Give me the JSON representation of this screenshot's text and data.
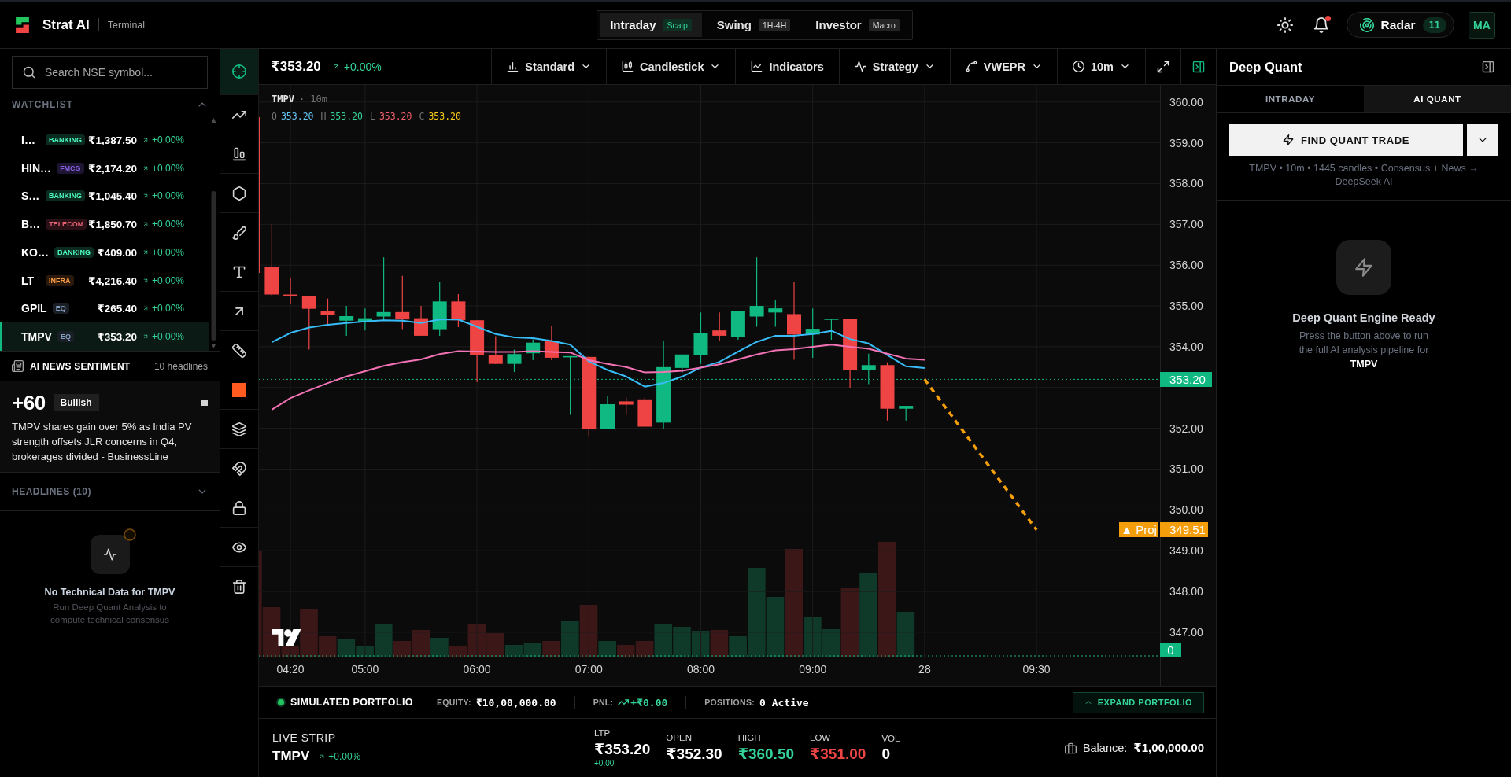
{
  "header": {
    "brand": "Strat AI",
    "subtitle": "Terminal",
    "modes": [
      {
        "label": "Intraday",
        "badge": "Scalp",
        "selected": true
      },
      {
        "label": "Swing",
        "badge": "1H-4H",
        "selected": false
      },
      {
        "label": "Investor",
        "badge": "Macro",
        "selected": false
      }
    ],
    "notifications_unread": true,
    "radar": {
      "label": "Radar",
      "count": "11"
    },
    "avatar": "MA"
  },
  "sidebar": {
    "search": {
      "placeholder": "Search NSE symbol..."
    },
    "watchlist": {
      "title": "WATCHLIST",
      "expanded": true,
      "items": [
        {
          "symbol": "I…",
          "tag": {
            "text": "BANKING",
            "color": "#0c2b20"
          },
          "price": "₹1,387.50",
          "change": "+0.00%",
          "selected": false
        },
        {
          "symbol": "HIN…",
          "tag": {
            "text": "FMCG",
            "color": "#1e1533"
          },
          "price": "₹2,174.20",
          "change": "+0.00%",
          "selected": false
        },
        {
          "symbol": "S…",
          "tag": {
            "text": "BANKING",
            "color": "#0c2b20"
          },
          "price": "₹1,045.40",
          "change": "+0.00%",
          "selected": false
        },
        {
          "symbol": "B…",
          "tag": {
            "text": "TELECOM",
            "color": "#2b1115"
          },
          "price": "₹1,850.70",
          "change": "+0.00%",
          "selected": false
        },
        {
          "symbol": "KO…",
          "tag": {
            "text": "BANKING",
            "color": "#0c2b20"
          },
          "price": "₹409.00",
          "change": "+0.00%",
          "selected": false
        },
        {
          "symbol": "LT",
          "tag": {
            "text": "INFRA",
            "color": "#2b1a0b"
          },
          "price": "₹4,216.40",
          "change": "+0.00%",
          "selected": false
        },
        {
          "symbol": "GPIL",
          "tag": {
            "text": "EQ",
            "color": "#1a1f26"
          },
          "price": "₹265.40",
          "change": "+0.00%",
          "selected": false
        },
        {
          "symbol": "TMPV",
          "tag": {
            "text": "EQ",
            "color": "#1a1f26"
          },
          "price": "₹353.20",
          "change": "+0.00%",
          "selected": true
        }
      ]
    },
    "news": {
      "title": "AI NEWS SENTIMENT",
      "count": "10 headlines",
      "score": "+60",
      "sentiment": "Bullish",
      "headline": "TMPV shares gain over 5% as India PV strength offsets JLR concerns in Q4, brokerages divided - BusinessLine"
    },
    "headlines": {
      "title": "HEADLINES (10)",
      "expanded": false
    },
    "technical": {
      "title": "No Technical Data for TMPV",
      "text": "Run Deep Quant Analysis to compute technical consensus"
    }
  },
  "tools": [
    {
      "kind": "crosshair",
      "selected": true
    },
    {
      "kind": "trend",
      "selected": false
    },
    {
      "kind": "indicator",
      "selected": false
    },
    {
      "kind": "shape",
      "selected": false
    },
    {
      "kind": "brush",
      "selected": false
    },
    {
      "kind": "text",
      "selected": false
    },
    {
      "kind": "arrow",
      "selected": false
    },
    {
      "kind": "measure",
      "selected": false
    },
    {
      "kind": "color",
      "color": "#ff5a1f",
      "selected": false
    },
    {
      "kind": "layers",
      "selected": false
    },
    {
      "kind": "magnet",
      "selected": false
    },
    {
      "kind": "lock",
      "selected": false
    },
    {
      "kind": "visibility",
      "selected": false
    },
    {
      "kind": "delete",
      "selected": false
    }
  ],
  "chart": {
    "price": "₹353.20",
    "change": "+0.00%",
    "toolbar": [
      {
        "kind": "menu",
        "label": "Standard",
        "active": false
      },
      {
        "kind": "menu",
        "label": "Candlestick",
        "active": false
      },
      {
        "kind": "button",
        "label": "Indicators",
        "active": false
      },
      {
        "kind": "menu",
        "label": "Strategy",
        "active": false
      },
      {
        "kind": "menu",
        "label": "VWEPR",
        "active": false
      },
      {
        "kind": "menu",
        "label": "10m",
        "active": false
      },
      {
        "kind": "icon",
        "active": false
      },
      {
        "kind": "icon",
        "active": true
      }
    ],
    "legend": {
      "symbol": "TMPV",
      "interval": "· 10m",
      "ohlc": [
        {
          "label": "O",
          "value": "353.20",
          "color": "#67c7f5"
        },
        {
          "label": "H",
          "value": "353.20",
          "color": "#34d399"
        },
        {
          "label": "L",
          "value": "353.20",
          "color": "#f0616d"
        },
        {
          "label": "C",
          "value": "353.20",
          "color": "#facc15"
        }
      ]
    },
    "projection_tag": {
      "note": "▲ Proj",
      "value": "349.51"
    },
    "volume_tag": "0",
    "chart_data": {
      "type": "line",
      "grid": true,
      "categories": [
        null,
        null,
        "04:20",
        null,
        null,
        null,
        "05:00",
        null,
        null,
        null,
        null,
        null,
        "06:00",
        null,
        null,
        null,
        null,
        null,
        "07:00",
        null,
        null,
        null,
        null,
        null,
        "08:00",
        null,
        null,
        null,
        null,
        null,
        "09:00",
        null,
        null,
        null,
        null,
        null,
        "28",
        null,
        null,
        null,
        null,
        null,
        "09:30"
      ],
      "ylim": [
        346.4,
        360.42
      ],
      "yticks": [
        {
          "value": 360,
          "label": "360.00"
        },
        {
          "value": 359,
          "label": "359.00"
        },
        {
          "value": 358,
          "label": "358.00"
        },
        {
          "value": 357,
          "label": "357.00"
        },
        {
          "value": 356,
          "label": "356.00"
        },
        {
          "value": 355,
          "label": "355.00"
        },
        {
          "value": 354,
          "label": "354.00"
        },
        {
          "value": 352,
          "label": "352.00"
        },
        {
          "value": 351,
          "label": "351.00"
        },
        {
          "value": 350,
          "label": "350.00"
        },
        {
          "value": 349,
          "label": "349.00"
        },
        {
          "value": 348,
          "label": "348.00"
        },
        {
          "value": 347,
          "label": "347.00"
        }
      ],
      "series": [
        {
          "color": "#38bdf8",
          "line_style": "solid",
          "values": [
            null,
            354.11,
            354.34,
            354.47,
            354.54,
            354.58,
            354.62,
            354.65,
            354.64,
            354.58,
            354.67,
            354.67,
            354.49,
            354.31,
            354.23,
            354.21,
            354.14,
            354.05,
            353.64,
            353.43,
            353.27,
            353.02,
            353.11,
            353.27,
            353.49,
            353.63,
            353.88,
            354.12,
            354.27,
            354.27,
            354.31,
            354.39,
            354.19,
            354.08,
            353.8,
            353.52,
            353.48,
            null,
            null,
            null,
            null,
            null,
            null
          ]
        },
        {
          "color": "#f472b6",
          "line_style": "solid",
          "values": [
            null,
            352.46,
            352.74,
            352.93,
            353.11,
            353.27,
            353.4,
            353.53,
            353.62,
            353.69,
            353.82,
            353.89,
            353.88,
            353.87,
            353.87,
            353.89,
            353.87,
            353.86,
            353.67,
            353.58,
            353.5,
            353.37,
            353.38,
            353.41,
            353.49,
            353.57,
            353.69,
            353.81,
            353.91,
            353.94,
            354.0,
            354.05,
            354.0,
            353.95,
            353.83,
            353.71,
            353.68,
            null,
            null,
            null,
            null,
            null,
            null
          ]
        },
        {
          "color": "#f59e0b",
          "line_style": "dashed",
          "values": [
            null,
            null,
            null,
            null,
            null,
            null,
            null,
            null,
            null,
            null,
            null,
            null,
            null,
            null,
            null,
            null,
            null,
            null,
            null,
            null,
            null,
            null,
            null,
            null,
            null,
            null,
            null,
            null,
            null,
            null,
            null,
            null,
            null,
            null,
            null,
            null,
            353.2,
            null,
            null,
            null,
            null,
            null,
            349.51
          ]
        }
      ],
      "ref_lines": [
        {
          "axis": "y",
          "value": 353.2,
          "label": "353.20",
          "color": "#10b981",
          "line_style": "dotted"
        }
      ]
    }
  },
  "portfolio": {
    "title": "SIMULATED PORTFOLIO",
    "color": "#22c55e",
    "equity_label": "EQUITY:",
    "equity": "₹10,00,000.00",
    "pnl_label": "PNL:",
    "pnl": "+₹0.00",
    "positions_label": "POSITIONS:",
    "positions": "0 Active",
    "button": "EXPAND PORTFOLIO"
  },
  "live_strip": {
    "title": "LIVE STRIP",
    "symbol": "TMPV",
    "change": "+0.00%",
    "stats": [
      {
        "label": "LTP",
        "value": "₹353.20",
        "sub": "+0.00",
        "color": "#ffffff"
      },
      {
        "label": "OPEN",
        "value": "₹352.30",
        "color": "#ffffff"
      },
      {
        "label": "HIGH",
        "value": "₹360.50",
        "color": "#34d399"
      },
      {
        "label": "LOW",
        "value": "₹351.00",
        "color": "#ef4444"
      },
      {
        "label": "VOL",
        "value": "0",
        "color": "#ffffff"
      }
    ],
    "balance_label": "Balance:",
    "balance": "₹1,00,000.00"
  },
  "deep_quant": {
    "title": "Deep Quant",
    "tabs": [
      {
        "label": "INTRADAY",
        "selected": false
      },
      {
        "label": "AI QUANT",
        "selected": true
      }
    ],
    "button": "FIND QUANT TRADE",
    "caption": "TMPV • 10m • 1445 candles • Consensus + News → DeepSeek AI",
    "empty_title": "Deep Quant Engine Ready",
    "empty_text": "Press the button above to run the full AI analysis pipeline for **TMPV**"
  }
}
